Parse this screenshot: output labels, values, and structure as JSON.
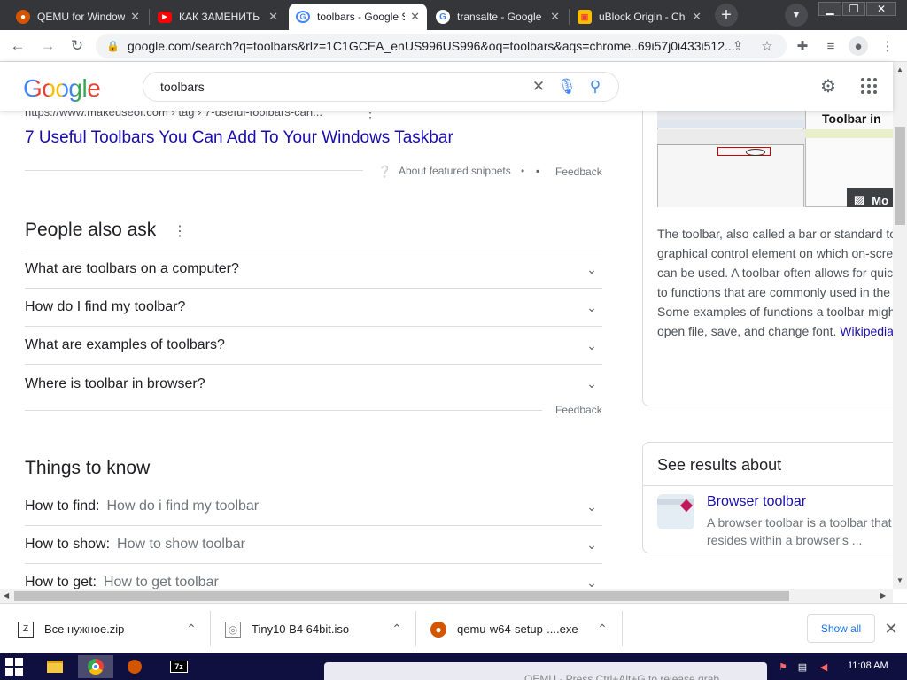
{
  "tabs": [
    {
      "title": "QEMU for Windows",
      "favicon": "qemu-icon",
      "active": false
    },
    {
      "title": "КАК ЗАМЕНИТЬ НА",
      "favicon": "youtube-icon",
      "active": false
    },
    {
      "title": "toolbars - Google Search",
      "favicon": "google-g-icon",
      "active": true
    },
    {
      "title": "transalte - Google Search",
      "favicon": "google-g-icon",
      "active": false
    },
    {
      "title": "uBlock Origin - Chrome Web Store",
      "favicon": "chrome-web-store-icon",
      "active": false
    }
  ],
  "address": {
    "url": "google.com/search?q=toolbars&rlz=1C1GCEA_enUS996US996&oq=toolbars&aqs=chrome..69i57j0i433i512..."
  },
  "search": {
    "logo": "Google",
    "query": "toolbars"
  },
  "featured": {
    "cite": "https://www.makeuseof.com › tag › 7-useful-toolbars-can...",
    "link": "7 Useful Toolbars You Can Add To Your Windows Taskbar",
    "about": "About featured snippets",
    "feedback": "Feedback"
  },
  "paa": {
    "title": "People also ask",
    "questions": [
      "What are toolbars on a computer?",
      "How do I find my toolbar?",
      "What are examples of toolbars?",
      "Where is toolbar in browser?"
    ],
    "feedback": "Feedback"
  },
  "ttk": {
    "title": "Things to know",
    "items": [
      {
        "k": "How to find:",
        "v": "How do i find my toolbar"
      },
      {
        "k": "How to show:",
        "v": "How to show toolbar"
      },
      {
        "k": "How to get:",
        "v": "How to get toolbar"
      }
    ]
  },
  "knowledge": {
    "image_caption": "Toolbar in",
    "more_label": "Mo",
    "description_lines": [
      "The toolbar, also called a bar or standard to",
      "graphical control element on which on-scre",
      "can be used. A toolbar often allows for quic",
      "to functions that are commonly used in the",
      "Some examples of functions a toolbar migh",
      "open file, save, and change font."
    ],
    "source": "Wikipedia"
  },
  "see_results": {
    "title": "See results about",
    "item_title": "Browser toolbar",
    "item_line1": "A browser toolbar is a toolbar that",
    "item_line2": "resides within a browser's ..."
  },
  "downloads": [
    {
      "name": "Все нужное.zip",
      "icon": "zip-file-icon"
    },
    {
      "name": "Tiny10 B4 64bit.iso",
      "icon": "disc-file-icon"
    },
    {
      "name": "qemu-w64-setup-....exe",
      "icon": "qemu-installer-icon"
    }
  ],
  "download_bar": {
    "show_all": "Show all"
  },
  "taskbar": {
    "window_title": "QEMU - Press Ctrl+Alt+G to release grab",
    "clock": "11:08 AM"
  },
  "colors": {
    "link": "#1a0dab",
    "tabstrip": "#35363a",
    "taskbar": "#0f103f"
  }
}
